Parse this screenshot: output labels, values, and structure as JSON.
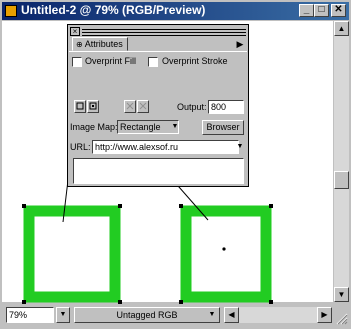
{
  "window": {
    "title": "Untitled-2 @ 79% (RGB/Preview)",
    "buttons": {
      "minimize": "_",
      "maximize": "□",
      "close": "✕"
    }
  },
  "attributes_panel": {
    "tab_label": "Attributes",
    "overprint_fill": {
      "label": "Overprint Fill",
      "checked": false
    },
    "overprint_stroke": {
      "label": "Overprint Stroke",
      "checked": false
    },
    "output_label": "Output:",
    "output_value": "800",
    "image_map_label": "Image Map:",
    "image_map_value": "Rectangle",
    "browser_button": "Browser",
    "url_label": "URL:",
    "url_value": "http://www.alexsof.ru",
    "notes_value": ""
  },
  "status_bar": {
    "zoom": "79%",
    "profile": "Untagged RGB"
  },
  "colors": {
    "title_bar": "#0a246a",
    "shape_stroke": "#22cc22",
    "canvas": "#ffffff"
  }
}
